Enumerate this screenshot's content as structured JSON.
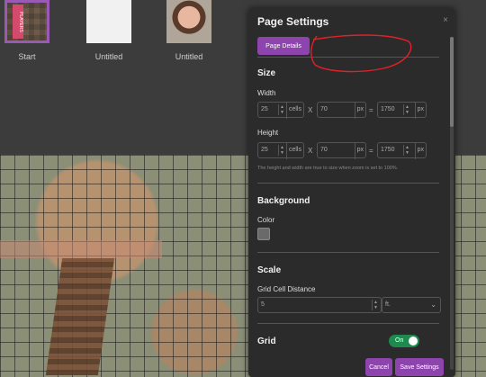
{
  "pages": [
    {
      "label": "Start",
      "badge": "PLAYERS"
    },
    {
      "label": "Untitled"
    },
    {
      "label": "Untitled"
    }
  ],
  "dialog": {
    "title": "Page Settings",
    "close": "×",
    "tab": "Page Details",
    "size": {
      "title": "Size",
      "width": {
        "label": "Width",
        "cells": "25",
        "cells_unit": "cells",
        "px": "70",
        "px_unit": "px",
        "total": "1750",
        "total_unit": "px"
      },
      "height": {
        "label": "Height",
        "cells": "25",
        "cells_unit": "cells",
        "px": "70",
        "px_unit": "px",
        "total": "1750",
        "total_unit": "px"
      },
      "times": "X",
      "equals": "=",
      "helper": "The height and width are true to size when zoom is set to 100%."
    },
    "background": {
      "title": "Background",
      "color_label": "Color",
      "color": "#6a6a6a"
    },
    "scale": {
      "title": "Scale",
      "distance_label": "Grid Cell Distance",
      "distance": "5",
      "unit": "ft."
    },
    "grid": {
      "title": "Grid",
      "toggle": "On",
      "on": true
    },
    "cancel": "Cancel",
    "save": "Save Settings"
  }
}
